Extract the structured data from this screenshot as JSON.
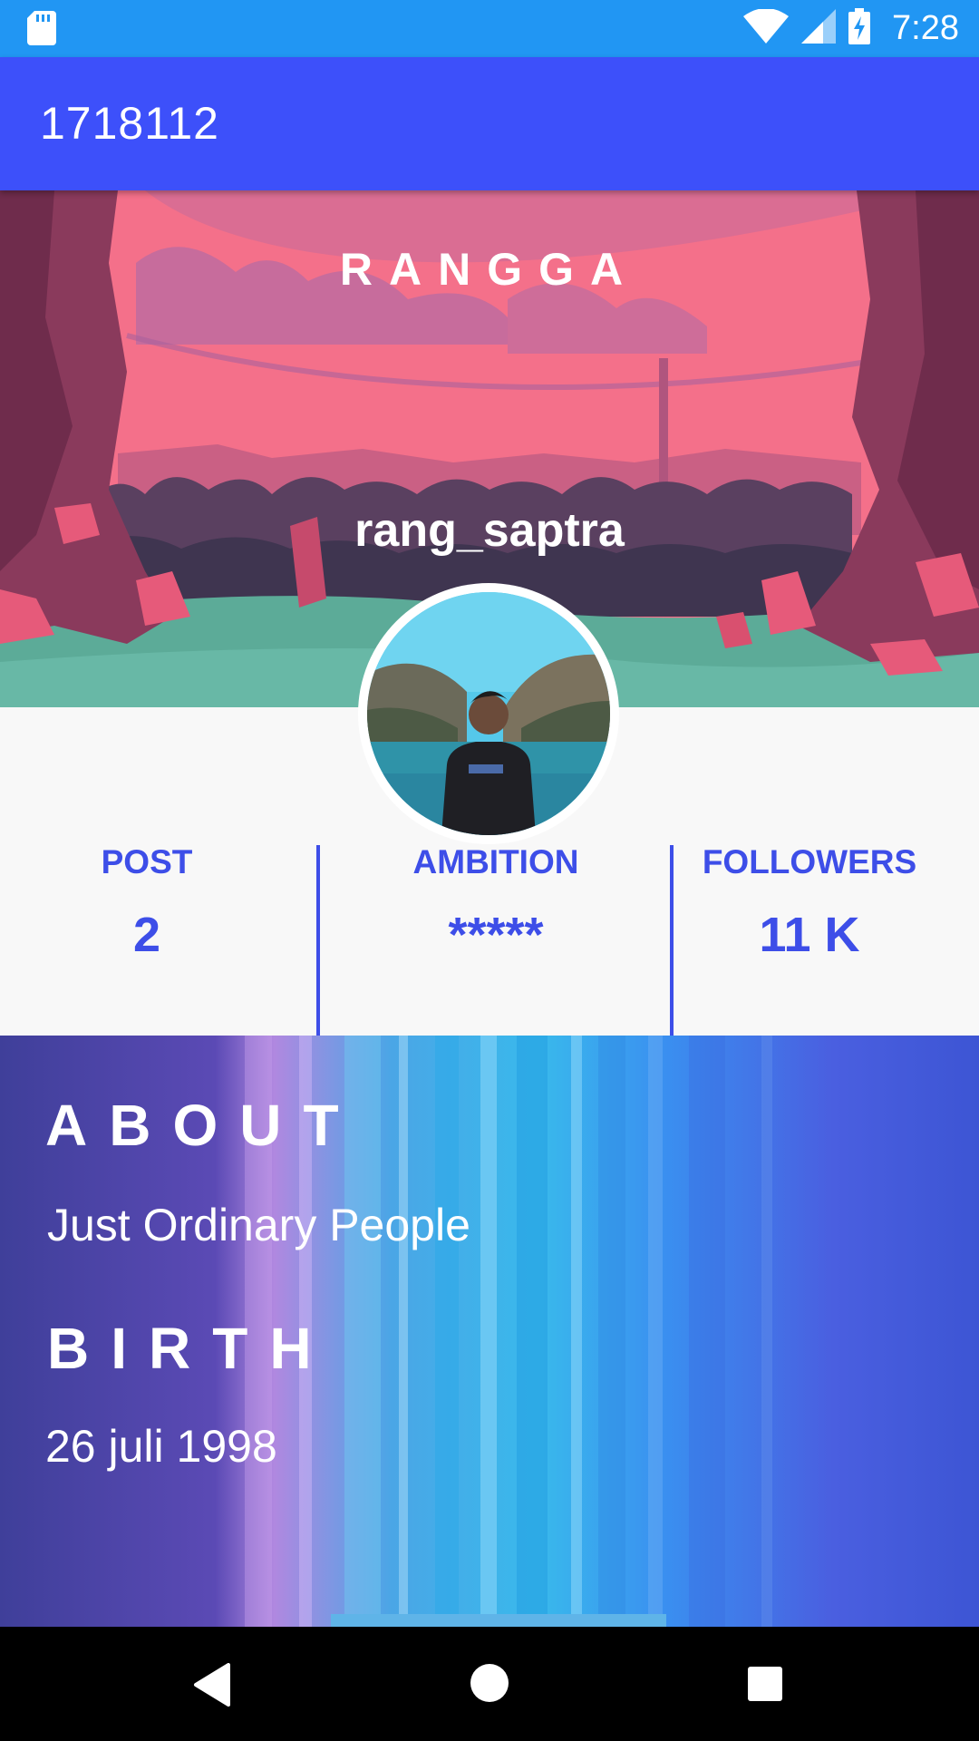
{
  "status_bar": {
    "time": "7:28"
  },
  "app_bar": {
    "title": "1718112"
  },
  "profile": {
    "name": "RANGGA",
    "username": "rang_saptra"
  },
  "stats": [
    {
      "label": "POST",
      "value": "2"
    },
    {
      "label": "AMBITION",
      "value": "*****"
    },
    {
      "label": "FOLLOWERS",
      "value": "11 K"
    }
  ],
  "about": {
    "about_heading": "ABOUT",
    "about_text": "Just Ordinary People",
    "birth_heading": "BIRTH",
    "birth_text": "26 juli 1998"
  },
  "colors": {
    "status_bar": "#2196f3",
    "app_bar": "#3d50fa",
    "accent": "#3d4ee8"
  },
  "icons": [
    "sd-card-icon",
    "wifi-icon",
    "signal-icon",
    "battery-charging-icon",
    "back-icon",
    "home-icon",
    "recents-icon"
  ]
}
